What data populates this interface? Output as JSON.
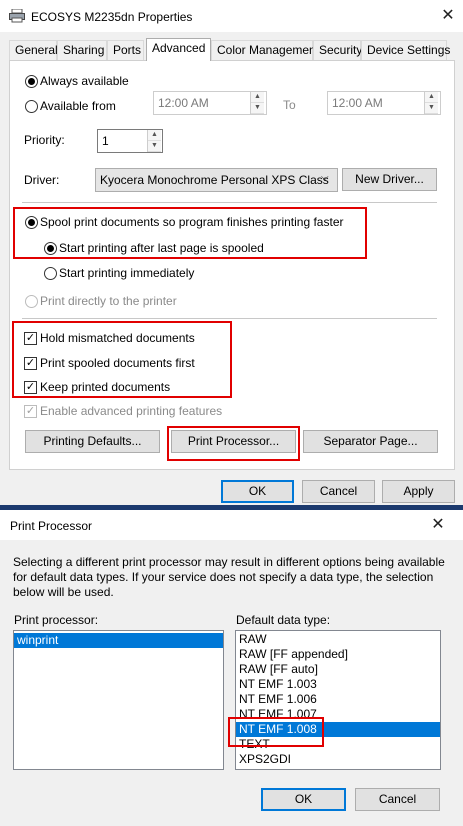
{
  "properties_window": {
    "title": "ECOSYS M2235dn Properties",
    "tabs": [
      {
        "label": "General"
      },
      {
        "label": "Sharing"
      },
      {
        "label": "Ports"
      },
      {
        "label": "Advanced"
      },
      {
        "label": "Color Management"
      },
      {
        "label": "Security"
      },
      {
        "label": "Device Settings"
      }
    ],
    "availability": {
      "always_label": "Always available",
      "from_label": "Available from",
      "from_time": "12:00 AM",
      "to_label": "To",
      "to_time": "12:00 AM"
    },
    "priority": {
      "label": "Priority:",
      "value": "1"
    },
    "driver": {
      "label": "Driver:",
      "value": "Kyocera Monochrome Personal XPS Class",
      "new_driver_label": "New Driver..."
    },
    "spool": {
      "spool_label": "Spool print documents so program finishes printing faster",
      "after_last_page_label": "Start printing after last page is spooled",
      "immediately_label": "Start printing immediately",
      "direct_label": "Print directly to the printer"
    },
    "options": {
      "hold_mismatched_label": "Hold mismatched documents",
      "spooled_first_label": "Print spooled documents first",
      "keep_printed_label": "Keep printed documents",
      "advanced_features_label": "Enable advanced printing features"
    },
    "buttons": {
      "printing_defaults": "Printing Defaults...",
      "print_processor": "Print Processor...",
      "separator_page": "Separator Page...",
      "ok": "OK",
      "cancel": "Cancel",
      "apply": "Apply"
    }
  },
  "print_processor_dialog": {
    "title": "Print Processor",
    "description": "Selecting a different print processor may result in different options being available for default data types. If your service does not specify a data type, the selection below will be used.",
    "processor_label": "Print processor:",
    "processors": [
      {
        "label": "winprint"
      }
    ],
    "data_type_label": "Default data type:",
    "data_types": [
      {
        "label": "RAW"
      },
      {
        "label": "RAW [FF appended]"
      },
      {
        "label": "RAW [FF auto]"
      },
      {
        "label": "NT EMF 1.003"
      },
      {
        "label": "NT EMF 1.006"
      },
      {
        "label": "NT EMF 1.007"
      },
      {
        "label": "NT EMF 1.008"
      },
      {
        "label": "TEXT"
      },
      {
        "label": "XPS2GDI"
      }
    ],
    "ok": "OK",
    "cancel": "Cancel"
  },
  "colors": {
    "highlight_box": "#e10000",
    "selection": "#0078d7"
  },
  "icons": {
    "app_icon": "printer-icon",
    "close": "close-icon"
  }
}
